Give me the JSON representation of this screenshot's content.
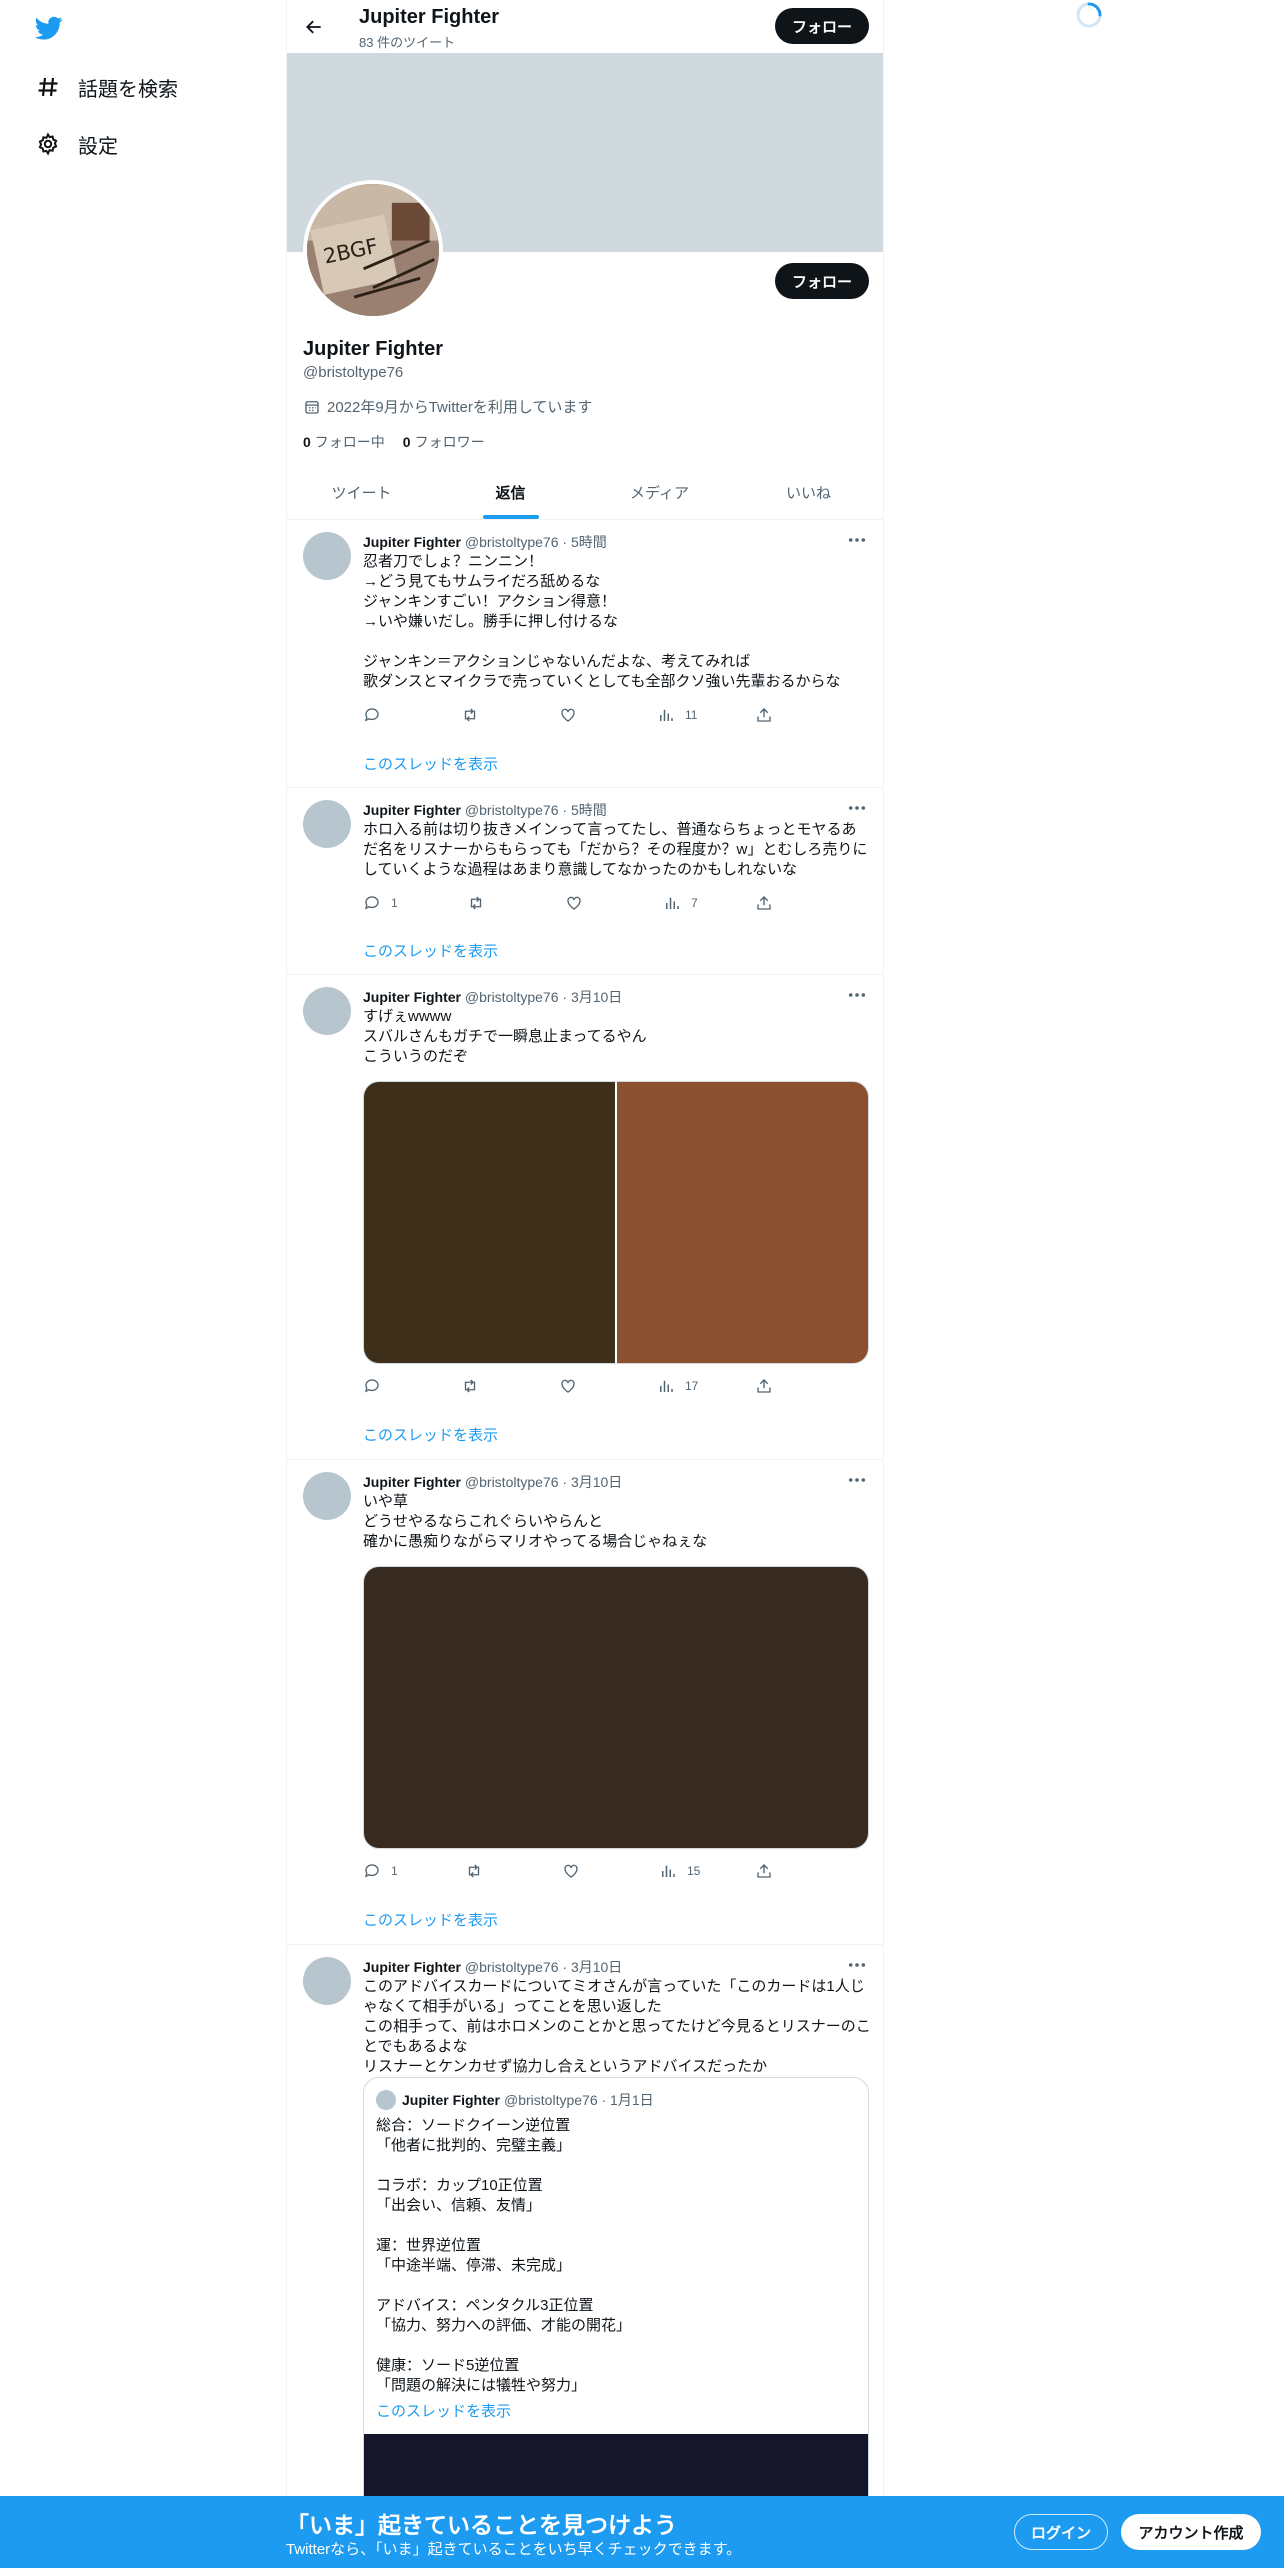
{
  "nav": {
    "items": [
      {
        "label": "話題を検索",
        "icon": "hashtag-icon"
      },
      {
        "label": "設定",
        "icon": "gear-icon"
      }
    ]
  },
  "header": {
    "name": "Jupiter Fighter",
    "tweet_count": "83 件のツイート",
    "follow_label": "フォロー"
  },
  "profile": {
    "name": "Jupiter Fighter",
    "handle": "@bristoltype76",
    "joined": "2022年9月からTwitterを利用しています",
    "following_count": "0",
    "following_label": "フォロー中",
    "followers_count": "0",
    "followers_label": "フォロワー",
    "follow_label": "フォロー"
  },
  "tabs": [
    {
      "label": "ツイート",
      "active": false
    },
    {
      "label": "返信",
      "active": true
    },
    {
      "label": "メディア",
      "active": false
    },
    {
      "label": "いいね",
      "active": false
    }
  ],
  "tweets": [
    {
      "name": "Jupiter Fighter",
      "meta": "@bristoltype76 · 5時間",
      "text": "忍者刀でしょ？ニンニン！\n→どう見てもサムライだろ舐めるな\nジャンキンすごい！アクション得意！\n→いや嫌いだし。勝手に押し付けるな\n\nジャンキン＝アクションじゃないんだよな、考えてみれば\n歌ダンスとマイクラで売っていくとしても全部クソ強い先輩おるからな",
      "replies": "",
      "views": "11",
      "thread_label": "このスレッドを表示"
    },
    {
      "name": "Jupiter Fighter",
      "meta": "@bristoltype76 · 5時間",
      "text": "ホロ入る前は切り抜きメインって言ってたし、普通ならちょっとモヤるあだ名をリスナーからもらっても「だから？その程度か？w」とむしろ売りにしていくような過程はあまり意識してなかったのかもしれないな",
      "replies": "1",
      "views": "7",
      "thread_label": "このスレッドを表示"
    },
    {
      "name": "Jupiter Fighter",
      "meta": "@bristoltype76 · 3月10日",
      "text": "すげぇwwww\nスバルさんもガチで一瞬息止まってるやん\nこういうのだぞ",
      "replies": "",
      "views": "17",
      "thread_label": "このスレッドを表示",
      "media_colors": [
        "#3e2f1a",
        "#8b5030"
      ]
    },
    {
      "name": "Jupiter Fighter",
      "meta": "@bristoltype76 · 3月10日",
      "text": "いや草\nどうせやるならこれぐらいやらんと\n確かに愚痴りながらマリオやってる場合じゃねぇな",
      "replies": "1",
      "views": "15",
      "thread_label": "このスレッドを表示",
      "media_colors": [
        "#372a21"
      ]
    },
    {
      "name": "Jupiter Fighter",
      "meta": "@bristoltype76 · 3月10日",
      "text": "このアドバイスカードについてミオさんが言っていた「このカードは1人じゃなくて相手がいる」ってことを思い返した\nこの相手って、前はホロメンのことかと思ってたけど今見るとリスナーのことでもあるよな\nリスナーとケンカせず協力し合えというアドバイスだったか",
      "quote": {
        "name": "Jupiter Fighter",
        "meta": "@bristoltype76 · 1月1日",
        "text": "総合：ソードクイーン逆位置\n「他者に批判的、完璧主義」\n\nコラボ：カップ10正位置\n「出会い、信頼、友情」\n\n運：世界逆位置\n「中途半端、停滞、未完成」\n\nアドバイス：ペンタクル3正位置\n「協力、努力への評価、才能の開花」\n\n健康：ソード5逆位置\n「問題の解決には犠牲や努力」",
        "thread_label": "このスレッドを表示"
      }
    }
  ],
  "bottom_bar": {
    "title": "「いま」起きていることを見つけよう",
    "subtitle": "Twitterなら、「いま」起きていることをいち早くチェックできます。",
    "login_label": "ログイン",
    "signup_label": "アカウント作成",
    "color": "#1d9bf0"
  },
  "colors": {
    "accent": "#1d9bf0",
    "text": "#0f1419",
    "muted": "#536471"
  }
}
